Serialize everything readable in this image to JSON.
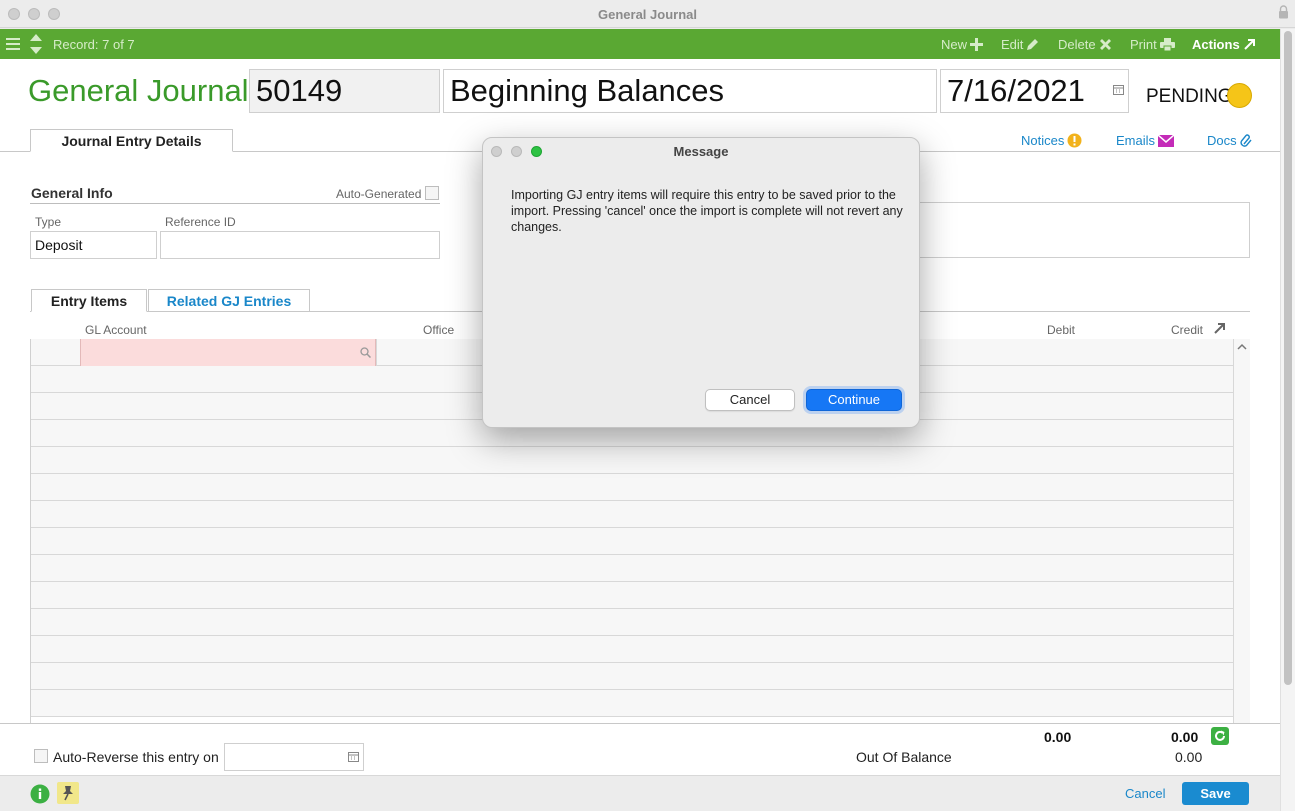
{
  "window": {
    "title": "General Journal"
  },
  "toolbar": {
    "record": "Record: 7 of 7",
    "new": "New",
    "edit": "Edit",
    "delete": "Delete",
    "print": "Print",
    "actions": "Actions"
  },
  "header": {
    "label": "General Journal:",
    "number": "50149",
    "description": "Beginning Balances",
    "date": "7/16/2021",
    "status": "PENDING",
    "status_color": "#f5c518"
  },
  "tabs": {
    "main": "Journal Entry Details"
  },
  "links": {
    "notices": "Notices",
    "emails": "Emails",
    "docs": "Docs"
  },
  "general_info": {
    "title": "General Info",
    "auto_generated": "Auto-Generated",
    "type_label": "Type",
    "type_value": "Deposit",
    "ref_label": "Reference ID",
    "ref_value": ""
  },
  "subtabs": {
    "entry_items": "Entry Items",
    "related": "Related GJ Entries"
  },
  "grid": {
    "columns": {
      "gl_account": "GL Account",
      "office": "Office",
      "debit": "Debit",
      "credit": "Credit"
    }
  },
  "footer": {
    "debit_total": "0.00",
    "credit_total": "0.00",
    "auto_reverse": "Auto-Reverse this entry on",
    "out_of_balance_label": "Out Of Balance",
    "out_of_balance_value": "0.00",
    "cancel": "Cancel",
    "save": "Save"
  },
  "dialog": {
    "title": "Message",
    "message": "Importing GJ entry items will require this entry to be saved prior to the import. Pressing 'cancel' once the import is complete will not revert any changes.",
    "cancel": "Cancel",
    "continue": "Continue"
  },
  "colors": {
    "toolbar": "#5aa833",
    "accent": "#1a87c9",
    "primary_button": "#1677f5"
  }
}
